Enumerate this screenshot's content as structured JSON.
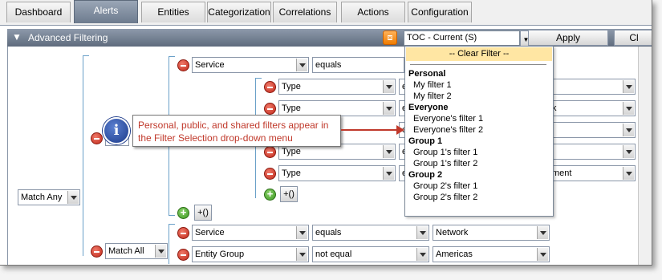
{
  "tabs": [
    "Dashboard",
    "Alerts",
    "Entities",
    "Categorization",
    "Correlations",
    "Actions",
    "Configuration"
  ],
  "active_tab": "Alerts",
  "panel": {
    "title": "Advanced Filtering"
  },
  "filter_select": {
    "value": "TOC - Current (S)"
  },
  "apply_label": "Apply",
  "next_button_label": "Cl",
  "match_any": "Match Any",
  "match_all": "Match All",
  "match_partial": "ch",
  "rows": {
    "r1": {
      "field": "Service",
      "op": "equals"
    },
    "r2": {
      "field": "Type",
      "op": "e",
      "val": ""
    },
    "r3": {
      "field": "Type",
      "op": "e",
      "val": "k"
    },
    "r4": {
      "field": "Type",
      "op": "e",
      "val": ""
    },
    "r5": {
      "field": "Type",
      "op": "e",
      "val": ""
    },
    "r6": {
      "field": "Type",
      "op": "e",
      "val": "ment"
    },
    "r7": {
      "field": "Service",
      "op": "equals",
      "val": "Network"
    },
    "r8": {
      "field": "Entity Group",
      "op": "not equal",
      "val": "Americas"
    }
  },
  "paren_label": "+()",
  "callout": {
    "text": "Personal, public, and shared filters appear in the Filter Selection drop-down menu",
    "icon": "info-icon"
  },
  "dropdown": {
    "clear": "-- Clear Filter --",
    "groups": [
      {
        "name": "Personal",
        "items": [
          "My filter 1",
          "My filter 2"
        ]
      },
      {
        "name": "Everyone",
        "items": [
          "Everyone's filter 1",
          "Everyone's filter 2"
        ]
      },
      {
        "name": "Group 1",
        "items": [
          "Group 1's filter 1",
          "Group 1's filter 2"
        ]
      },
      {
        "name": "Group 2",
        "items": [
          "Group 2's filter 1",
          "Group 2's filter 2"
        ]
      }
    ]
  },
  "colors": {
    "header": "#6d7b8e",
    "callout_text": "#c0392b",
    "clear_highlight": "#ffe6a3"
  }
}
